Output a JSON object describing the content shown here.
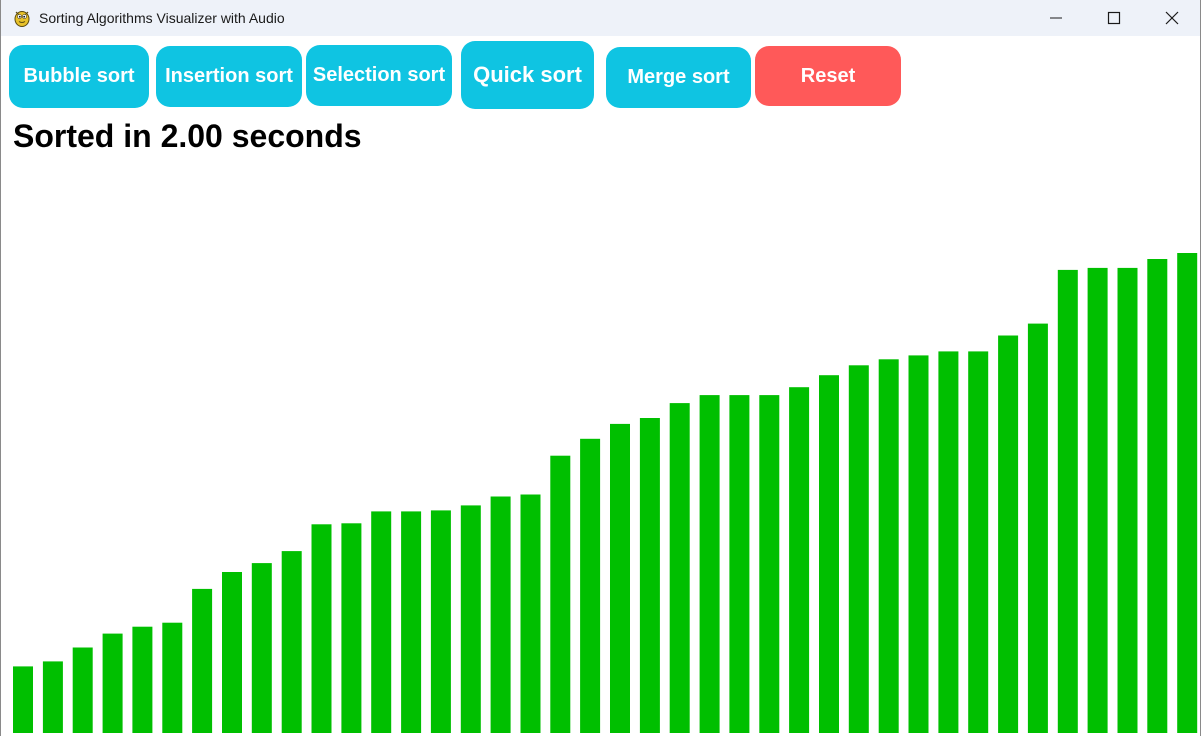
{
  "window": {
    "title": "Sorting Algorithms Visualizer with Audio",
    "app_icon": "pygame-snake-icon",
    "controls": [
      "minimize-icon",
      "maximize-icon",
      "close-icon"
    ]
  },
  "toolbar": {
    "bubble_label": "Bubble sort",
    "insertion_label": "Insertion sort",
    "selection_label": "Selection sort",
    "quick_label": "Quick sort",
    "merge_label": "Merge sort",
    "reset_label": "Reset"
  },
  "status": {
    "text": "Sorted in 2.00 seconds"
  },
  "colors": {
    "button_cyan": "#0fc4e2",
    "button_red": "#ff5959",
    "bar_green": "#00bf00"
  },
  "bars": {
    "values": [
      67,
      72,
      86,
      100,
      107,
      111,
      145,
      162,
      171,
      183,
      210,
      211,
      223,
      223,
      224,
      229,
      238,
      240,
      279,
      296,
      311,
      317,
      332,
      340,
      340,
      340,
      348,
      360,
      370,
      376,
      380,
      384,
      384,
      400,
      412,
      466,
      468,
      468,
      477,
      483
    ],
    "max_value": 483
  }
}
